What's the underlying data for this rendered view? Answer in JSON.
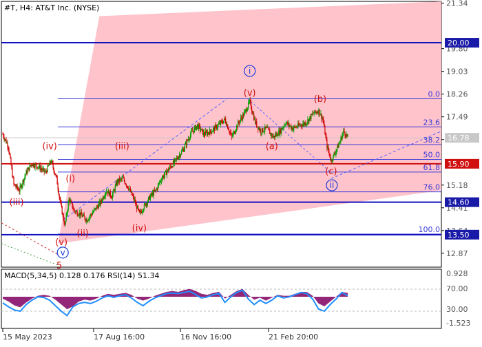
{
  "header": {
    "title": "#T, H4:  AT&T Inc. (NYSE)"
  },
  "indicator": {
    "label": "MACD(5,34,5) 0.128 0.176 RSI(14) 51.34",
    "macd_axis": [
      "0.928",
      "70.00",
      "30.00",
      "-1.523"
    ]
  },
  "colors": {
    "zone": "#ffc0c8",
    "level_line": "#1010c0",
    "fib_line": "#3a3ad8",
    "wave_label": "#d01010",
    "wave_major": "#1a3bd8",
    "candle_up": "#00a000",
    "candle_down": "#d00000",
    "trend_dash": "#5566ff",
    "macd_hist": "#800060",
    "macd_signal": "#1f8fff",
    "price_tag_blue": "#1a1aa8",
    "price_tag_red": "#d01010",
    "price_tag_grey": "#c8c8c8"
  },
  "chart_data": {
    "type": "candlestick",
    "title": "#T, H4:  AT&T Inc. (NYSE)",
    "ylim": [
      12.4,
      21.4
    ],
    "y_ticks": [
      "21.34",
      "19.80",
      "19.03",
      "18.26",
      "17.49",
      "16.72",
      "15.18",
      "14.41",
      "13.64",
      "12.87"
    ],
    "x_ticks": [
      "15 May 2023",
      "17 Aug 16:00",
      "16 Nov 16:00",
      "21 Feb 20:00"
    ],
    "close_path": [
      [
        0,
        16.9
      ],
      [
        8,
        16.5
      ],
      [
        16,
        15.2
      ],
      [
        24,
        15.0
      ],
      [
        34,
        15.6
      ],
      [
        42,
        15.9
      ],
      [
        52,
        15.8
      ],
      [
        62,
        15.6
      ],
      [
        70,
        16.0
      ],
      [
        78,
        15.4
      ],
      [
        84,
        14.5
      ],
      [
        90,
        13.8
      ],
      [
        96,
        14.7
      ],
      [
        104,
        14.3
      ],
      [
        112,
        14.2
      ],
      [
        122,
        14.0
      ],
      [
        132,
        14.3
      ],
      [
        142,
        14.6
      ],
      [
        150,
        15.0
      ],
      [
        158,
        14.8
      ],
      [
        166,
        15.3
      ],
      [
        174,
        15.4
      ],
      [
        182,
        15.1
      ],
      [
        190,
        14.7
      ],
      [
        198,
        14.2
      ],
      [
        206,
        14.5
      ],
      [
        214,
        14.8
      ],
      [
        222,
        15.0
      ],
      [
        230,
        15.4
      ],
      [
        240,
        15.7
      ],
      [
        250,
        16.0
      ],
      [
        262,
        16.4
      ],
      [
        272,
        16.9
      ],
      [
        282,
        17.2
      ],
      [
        292,
        16.9
      ],
      [
        302,
        17.0
      ],
      [
        312,
        17.2
      ],
      [
        322,
        17.4
      ],
      [
        332,
        16.8
      ],
      [
        342,
        17.3
      ],
      [
        350,
        17.6
      ],
      [
        358,
        18.0
      ],
      [
        366,
        17.3
      ],
      [
        374,
        17.0
      ],
      [
        382,
        17.1
      ],
      [
        392,
        16.8
      ],
      [
        402,
        17.0
      ],
      [
        410,
        17.3
      ],
      [
        420,
        17.1
      ],
      [
        430,
        17.2
      ],
      [
        440,
        17.3
      ],
      [
        450,
        17.6
      ],
      [
        458,
        17.7
      ],
      [
        464,
        17.4
      ],
      [
        470,
        16.5
      ],
      [
        476,
        16.0
      ],
      [
        482,
        16.3
      ],
      [
        488,
        16.6
      ],
      [
        494,
        17.0
      ],
      [
        500,
        16.8
      ]
    ],
    "price_tags": [
      {
        "value": 20.0,
        "label": "20.00",
        "style": "blue"
      },
      {
        "value": 16.78,
        "label": "16.78",
        "style": "grey"
      },
      {
        "value": 15.9,
        "label": "15.90",
        "style": "red"
      },
      {
        "value": 14.6,
        "label": "14.60",
        "style": "blue"
      },
      {
        "value": 13.5,
        "label": "13.50",
        "style": "blue"
      }
    ],
    "levels": [
      {
        "value": 20.0,
        "style": "solid-thick"
      },
      {
        "value": 15.9,
        "style": "red-thick"
      },
      {
        "value": 14.6,
        "style": "solid-thick"
      },
      {
        "value": 13.5,
        "style": "solid-thick"
      }
    ],
    "fibonacci": [
      {
        "label": "0.0",
        "value": 18.1
      },
      {
        "label": "23.6",
        "value": 17.15
      },
      {
        "label": "38.2",
        "value": 16.55
      },
      {
        "label": "50.0",
        "value": 16.05
      },
      {
        "label": "61.8",
        "value": 15.62
      },
      {
        "label": "76.0",
        "value": 14.95
      },
      {
        "label": "100.0",
        "value": 13.52
      }
    ],
    "wave_labels": [
      {
        "text": "(iii)",
        "x": 20,
        "y": 14.5,
        "style": "red"
      },
      {
        "text": "(iv)",
        "x": 68,
        "y": 16.4,
        "style": "red"
      },
      {
        "text": "(i)",
        "x": 98,
        "y": 15.3,
        "style": "red"
      },
      {
        "text": "(ii)",
        "x": 116,
        "y": 13.45,
        "style": "red"
      },
      {
        "text": "(iii)",
        "x": 173,
        "y": 16.4,
        "style": "red"
      },
      {
        "text": "(iv)",
        "x": 198,
        "y": 13.62,
        "style": "red"
      },
      {
        "text": "(v)",
        "x": 85,
        "y": 13.15,
        "style": "red"
      },
      {
        "text": "v",
        "x": 87,
        "y": 12.8,
        "style": "blue-circle"
      },
      {
        "text": "5",
        "x": 82,
        "y": 12.35,
        "style": "red"
      },
      {
        "text": "(v)",
        "x": 358,
        "y": 18.2,
        "style": "red"
      },
      {
        "text": "i",
        "x": 358,
        "y": 18.95,
        "style": "blue-circle"
      },
      {
        "text": "(a)",
        "x": 390,
        "y": 16.4,
        "style": "red"
      },
      {
        "text": "(b)",
        "x": 460,
        "y": 18.0,
        "style": "red"
      },
      {
        "text": "(c)",
        "x": 476,
        "y": 15.55,
        "style": "red"
      },
      {
        "text": "ii",
        "x": 477,
        "y": 15.08,
        "style": "blue-circle"
      }
    ],
    "macd_hist": [
      -0.2,
      -0.5,
      -0.9,
      -1.1,
      -0.6,
      -0.2,
      0.1,
      0.2,
      0.1,
      -0.3,
      -0.8,
      -1.3,
      -1.0,
      -0.5,
      -0.3,
      -0.4,
      -0.2,
      0.1,
      0.3,
      0.2,
      0.3,
      0.4,
      0.2,
      -0.2,
      -0.4,
      -0.2,
      0.1,
      0.3,
      0.5,
      0.6,
      0.5,
      0.7,
      0.8,
      0.6,
      0.3,
      0.2,
      0.4,
      0.5,
      -0.2,
      0.2,
      0.6,
      0.8,
      0.2,
      -0.3,
      -0.1,
      -0.4,
      -0.1,
      0.2,
      0.1,
      0.1,
      0.3,
      0.5,
      0.5,
      0.1,
      -0.7,
      -1.0,
      -0.5,
      0.0,
      0.5,
      0.4
    ],
    "rsi": [
      45,
      38,
      32,
      30,
      42,
      50,
      56,
      55,
      50,
      40,
      30,
      22,
      38,
      44,
      46,
      44,
      48,
      54,
      58,
      55,
      58,
      60,
      54,
      46,
      40,
      48,
      54,
      58,
      62,
      63,
      62,
      64,
      66,
      60,
      54,
      56,
      60,
      62,
      46,
      56,
      64,
      68,
      52,
      42,
      50,
      44,
      50,
      58,
      54,
      56,
      60,
      64,
      62,
      52,
      34,
      30,
      42,
      52,
      64,
      58
    ]
  }
}
